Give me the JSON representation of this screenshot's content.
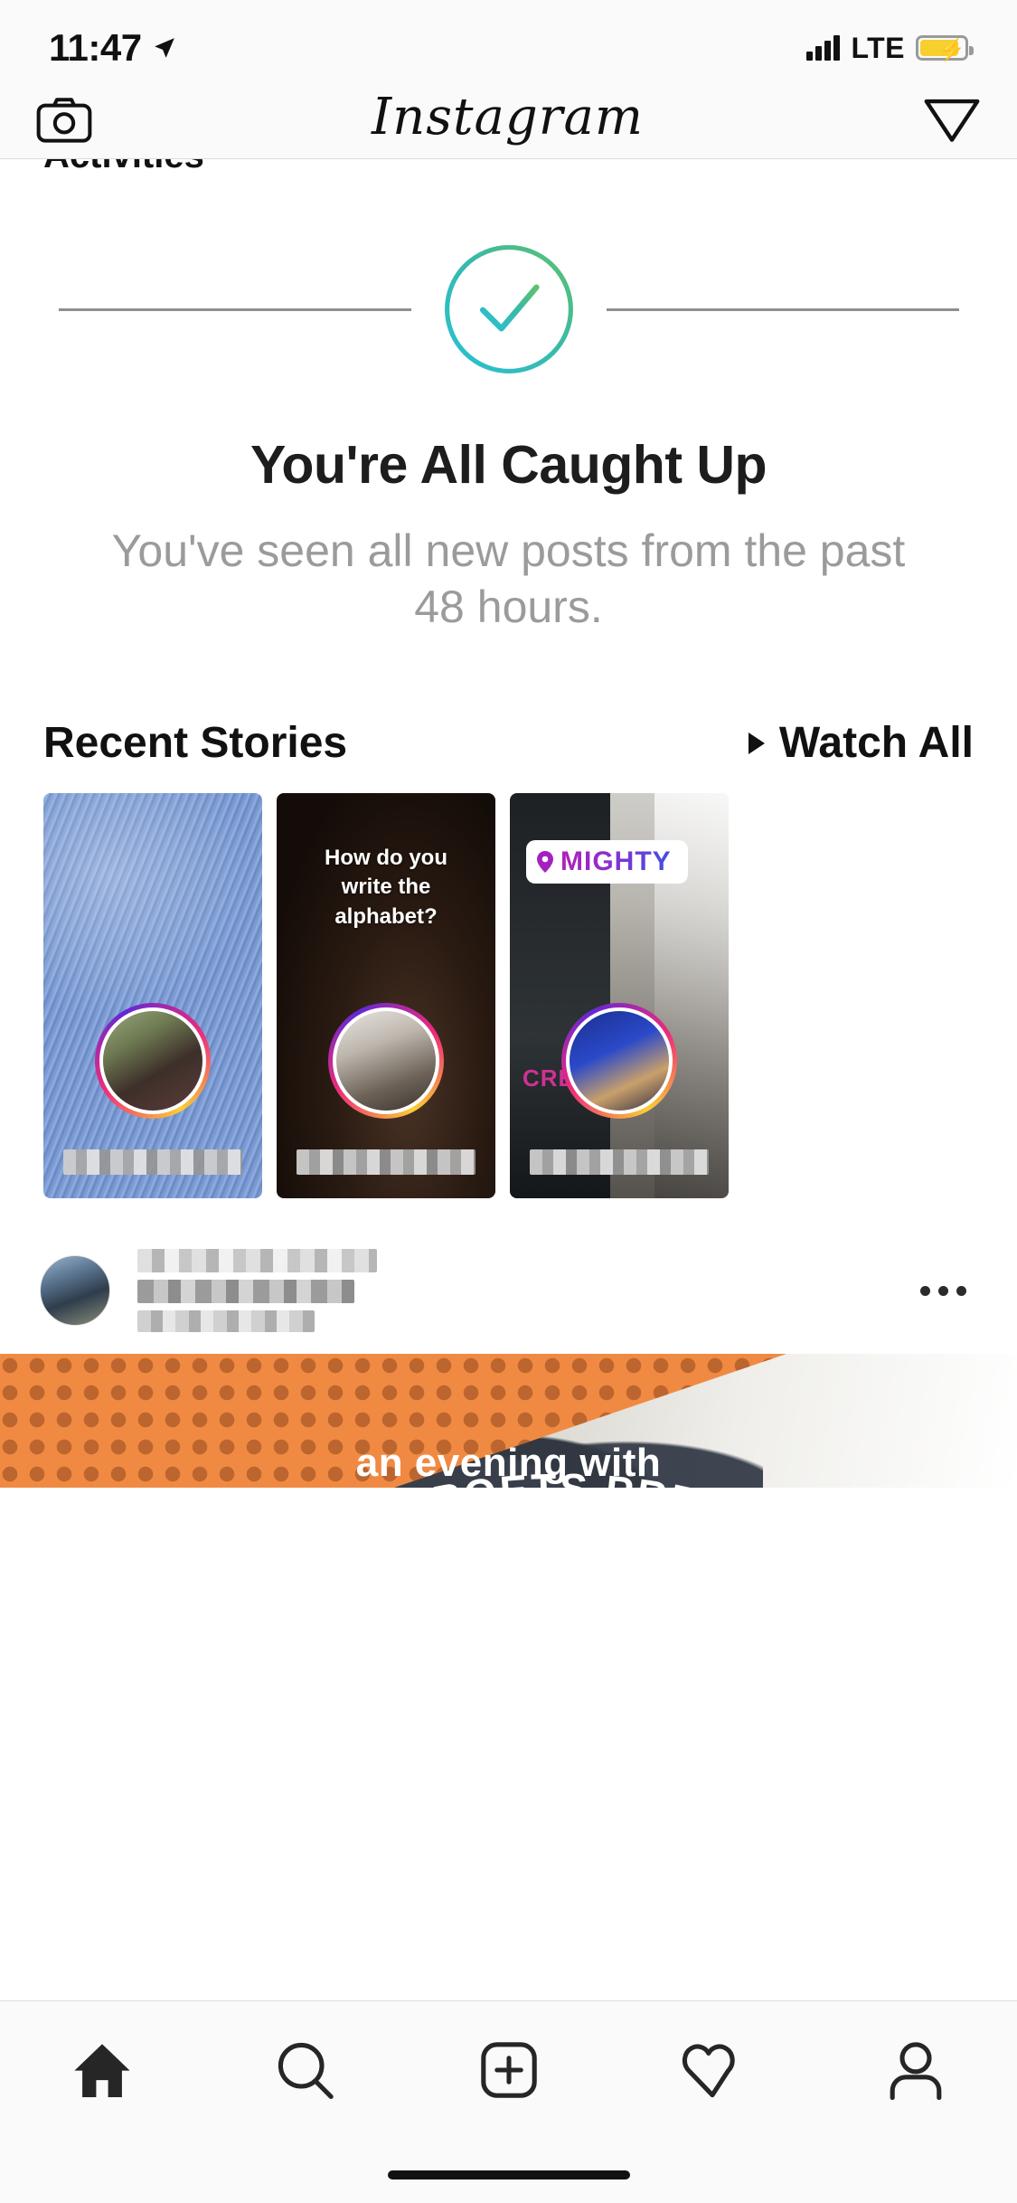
{
  "status_bar": {
    "time": "11:47",
    "location_icon": "location-arrow-icon",
    "signal_icon": "cellular-signal-icon",
    "network": "LTE",
    "battery_icon": "battery-charging-icon",
    "battery_color": "#f7cf2e"
  },
  "nav": {
    "camera_icon": "camera-icon",
    "title": "Instagram",
    "direct_icon": "send-paper-plane-icon"
  },
  "clipped_section": {
    "label": "Activities"
  },
  "caught_up": {
    "check_icon": "check-circle-icon",
    "gradient_start": "#5ec16e",
    "gradient_end": "#27c1d4",
    "divider_color": "#8e8e8e",
    "title": "You're All Caught Up",
    "subtitle": "You've seen all new posts from the past 48 hours."
  },
  "recent_stories": {
    "title": "Recent Stories",
    "watch_all_label": "Watch All",
    "play_icon": "play-triangle-icon",
    "cards": [
      {
        "name": "story-card-1",
        "overlay_text": "",
        "location_sticker": "",
        "username": "██████████",
        "avatar_ring": "instagram-gradient-ring"
      },
      {
        "name": "story-card-2",
        "overlay_text": "How do you write the alphabet?",
        "location_sticker": "",
        "username": "██████████",
        "avatar_ring": "instagram-gradient-ring"
      },
      {
        "name": "story-card-3",
        "overlay_text": "",
        "location_sticker": "MIGHTY",
        "location_pin_icon": "location-pin-icon",
        "sticker_text_gradient_start": "#b021b8",
        "sticker_text_gradient_end": "#3f51e0",
        "side_text": "CREAT",
        "username": "██████████",
        "avatar_ring": "instagram-gradient-ring"
      }
    ]
  },
  "post": {
    "avatar": "post-author-avatar",
    "username": "████████████",
    "more_icon": "more-options-icon",
    "image": {
      "headline": "STREET POETS PRESENTS",
      "subhead": "an evening with",
      "accent_color": "#f08a42"
    }
  },
  "tab_bar": {
    "items": [
      {
        "name": "tab-home",
        "icon": "home-icon",
        "active": true
      },
      {
        "name": "tab-search",
        "icon": "search-icon",
        "active": false
      },
      {
        "name": "tab-new-post",
        "icon": "plus-square-icon",
        "active": false
      },
      {
        "name": "tab-activity",
        "icon": "heart-icon",
        "active": false
      },
      {
        "name": "tab-profile",
        "icon": "person-icon",
        "active": false
      }
    ],
    "home_indicator": "home-indicator-bar"
  }
}
